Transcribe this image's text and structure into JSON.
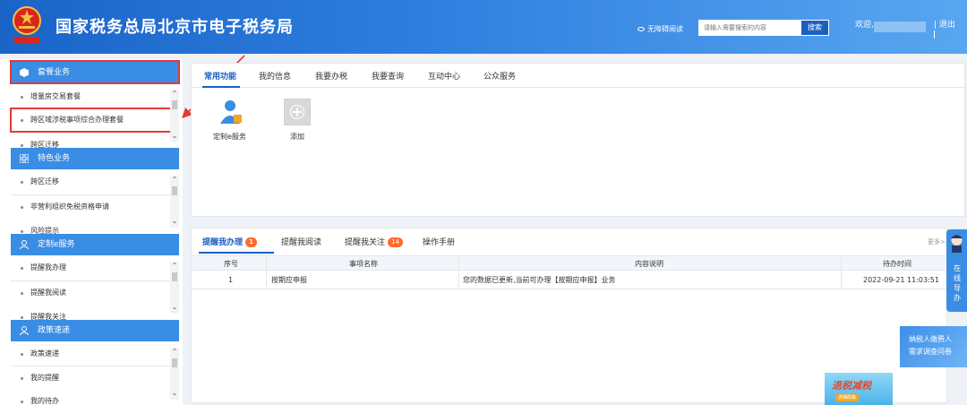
{
  "header": {
    "title": "国家税务总局北京市电子税务局",
    "accessibility": "无障碍阅读",
    "search_placeholder": "请输入需要搜索的内容",
    "search_button": "搜索",
    "welcome": "欢迎,",
    "logout": "退出"
  },
  "sidebar": {
    "sections": [
      {
        "title": "套餐业务",
        "items": [
          "增量房交易套餐",
          "跨区域涉税事项综合办理套餐",
          "跨区迁移"
        ]
      },
      {
        "title": "特色业务",
        "items": [
          "跨区迁移",
          "非营利组织免税资格申请",
          "风险提示"
        ]
      },
      {
        "title": "定制e服务",
        "items": [
          "提醒我办理",
          "提醒我阅读",
          "提醒我关注"
        ]
      },
      {
        "title": "政策速递",
        "items": [
          "政策速递",
          "我的提醒",
          "我的待办"
        ]
      }
    ]
  },
  "top_panel": {
    "tabs": [
      "常用功能",
      "我的信息",
      "我要办税",
      "我要查询",
      "互动中心",
      "公众服务"
    ],
    "apps": [
      {
        "label": "定制e服务",
        "icon": "person-service-icon"
      },
      {
        "label": "添加",
        "icon": "add-circle-icon"
      }
    ]
  },
  "bottom_panel": {
    "tabs": [
      {
        "label": "提醒我办理",
        "badge": "1"
      },
      {
        "label": "提醒我阅读",
        "badge": ""
      },
      {
        "label": "提醒我关注",
        "badge": "14"
      },
      {
        "label": "操作手册",
        "badge": ""
      }
    ],
    "more": "更多>",
    "columns": [
      "序号",
      "事项名称",
      "内容说明",
      "待办时间"
    ],
    "rows": [
      {
        "no": "1",
        "name": "按期应申报",
        "desc": "您的数据已更新,当前可办理【按期应申报】业务",
        "time": "2022-09-21 11:03:51"
      }
    ]
  },
  "floating": {
    "guide": "在线导办",
    "survey_line1": "纳税人缴费人",
    "survey_line2": "需求调查问卷",
    "promo_title": "退税减税",
    "promo_sub": "详细政策"
  },
  "colors": {
    "header_blue": "#2f7fe0",
    "accent_blue": "#3a8de4",
    "highlight_red": "#e53935",
    "badge_orange": "#ff6a2b"
  }
}
